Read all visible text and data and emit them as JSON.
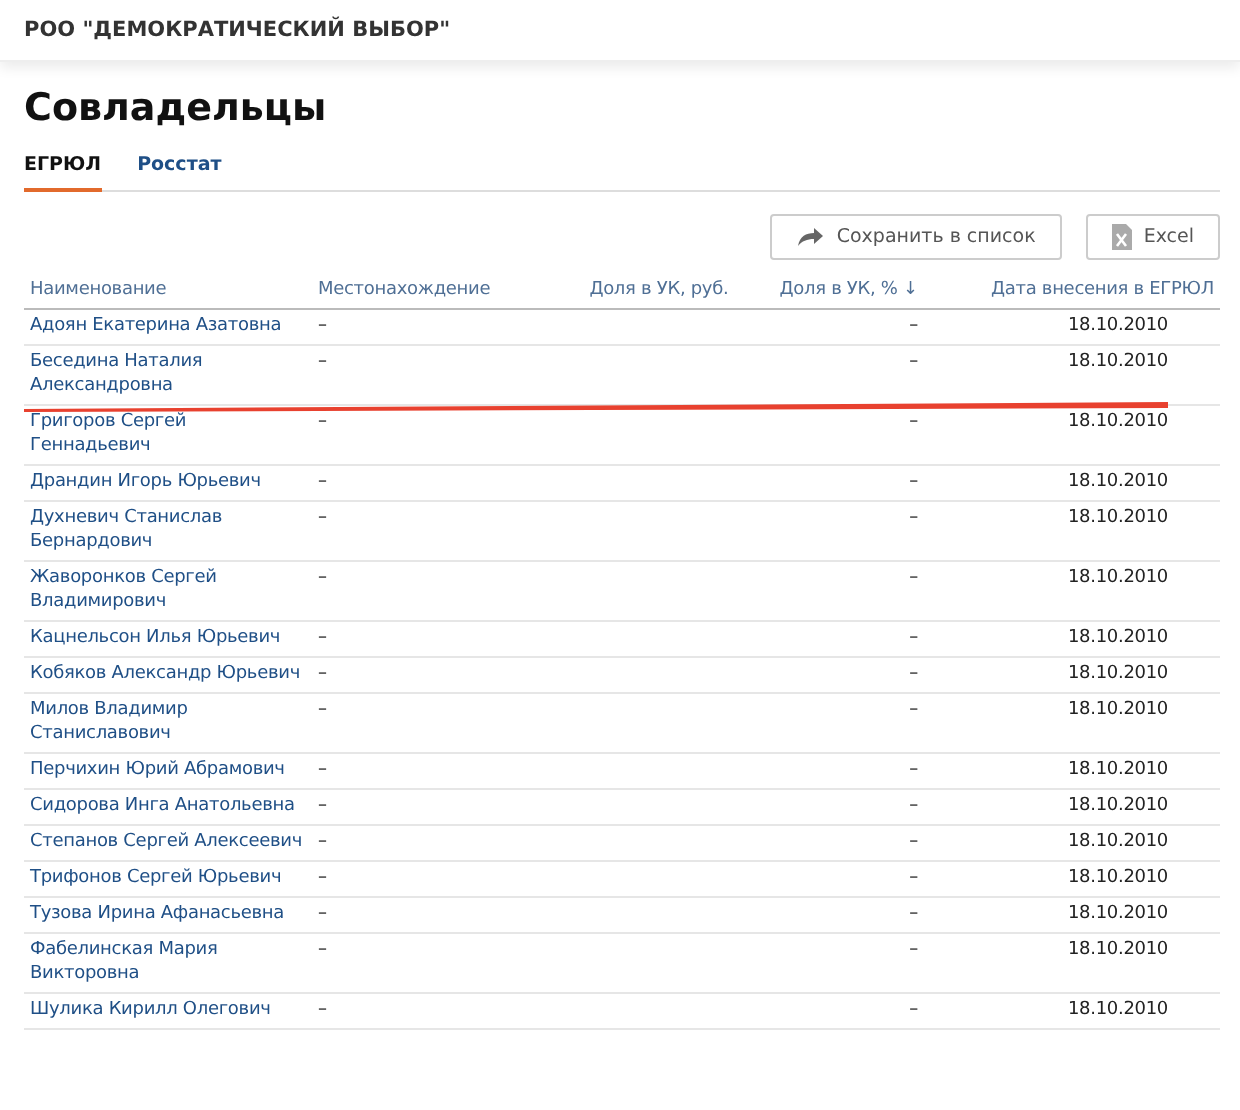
{
  "org_title": "РОО \"ДЕМОКРАТИЧЕСКИЙ ВЫБОР\"",
  "heading": "Совладельцы",
  "tabs": [
    {
      "label": "ЕГРЮЛ",
      "selected": true
    },
    {
      "label": "Росстат",
      "selected": false
    }
  ],
  "buttons": [
    {
      "kind": "share",
      "label": "Сохранить в список"
    },
    {
      "kind": "excel",
      "label": "Excel"
    }
  ],
  "table": {
    "columns": [
      "Наименование",
      "Местонахождение",
      "Доля в УК, руб.",
      "Доля в УК, % ↓",
      "Дата внесения в ЕГРЮЛ"
    ],
    "rows": [
      {
        "name": "Адоян Екатерина Азатовна",
        "location": "–",
        "share_percent": "–",
        "date": "18.10.2010",
        "underlined": false
      },
      {
        "name": "Беседина Наталия Александровна",
        "location": "–",
        "share_percent": "–",
        "date": "18.10.2010",
        "underlined": true
      },
      {
        "name": "Григоров Сергей Геннадьевич",
        "location": "–",
        "share_percent": "–",
        "date": "18.10.2010",
        "underlined": false
      },
      {
        "name": "Драндин Игорь Юрьевич",
        "location": "–",
        "share_percent": "–",
        "date": "18.10.2010",
        "underlined": false
      },
      {
        "name": "Духневич Станислав Бернардович",
        "location": "–",
        "share_percent": "–",
        "date": "18.10.2010",
        "underlined": false
      },
      {
        "name": "Жаворонков Сергей Владимирович",
        "location": "–",
        "share_percent": "–",
        "date": "18.10.2010",
        "underlined": false
      },
      {
        "name": "Кацнельсон Илья Юрьевич",
        "location": "–",
        "share_percent": "–",
        "date": "18.10.2010",
        "underlined": false
      },
      {
        "name": "Кобяков Александр Юрьевич",
        "location": "–",
        "share_percent": "–",
        "date": "18.10.2010",
        "underlined": false
      },
      {
        "name": "Милов Владимир Станиславович",
        "location": "–",
        "share_percent": "–",
        "date": "18.10.2010",
        "underlined": false
      },
      {
        "name": "Перчихин Юрий Абрамович",
        "location": "–",
        "share_percent": "–",
        "date": "18.10.2010",
        "underlined": false
      },
      {
        "name": "Сидорова Инга Анатольевна",
        "location": "–",
        "share_percent": "–",
        "date": "18.10.2010",
        "underlined": false
      },
      {
        "name": "Степанов Сергей Алексеевич",
        "location": "–",
        "share_percent": "–",
        "date": "18.10.2010",
        "underlined": false
      },
      {
        "name": "Трифонов Сергей Юрьевич",
        "location": "–",
        "share_percent": "–",
        "date": "18.10.2010",
        "underlined": false
      },
      {
        "name": "Тузова Ирина Афанасьевна",
        "location": "–",
        "share_percent": "–",
        "date": "18.10.2010",
        "underlined": false
      },
      {
        "name": "Фабелинская Мария Викторовна",
        "location": "–",
        "share_percent": "–",
        "date": "18.10.2010",
        "underlined": false
      },
      {
        "name": "Шулика Кирилл Олегович",
        "location": "–",
        "share_percent": "–",
        "date": "18.10.2010",
        "underlined": false
      }
    ]
  }
}
